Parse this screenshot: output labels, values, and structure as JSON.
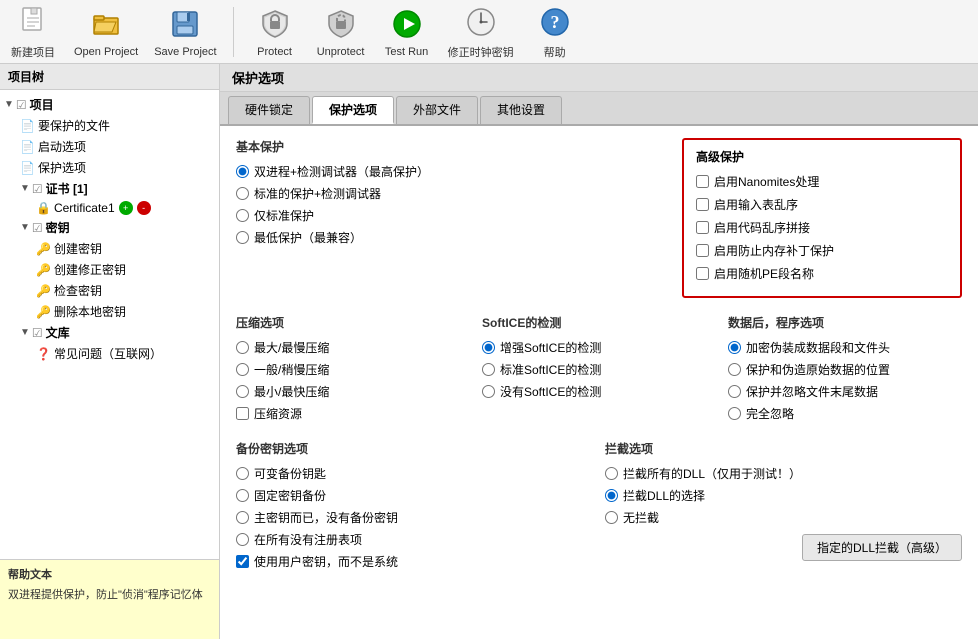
{
  "toolbar": {
    "items": [
      {
        "id": "new-project",
        "label": "新建项目",
        "icon": "📄"
      },
      {
        "id": "open-project",
        "label": "Open Project",
        "icon": "📂"
      },
      {
        "id": "save-project",
        "label": "Save Project",
        "icon": "💾"
      },
      {
        "id": "protect",
        "label": "Protect",
        "icon": "🔒"
      },
      {
        "id": "unprotect",
        "label": "Unprotect",
        "icon": "🔓"
      },
      {
        "id": "test-run",
        "label": "Test Run",
        "icon": "▶"
      },
      {
        "id": "fix-clock-key",
        "label": "修正时钟密钥",
        "icon": "🕐"
      },
      {
        "id": "help",
        "label": "帮助",
        "icon": "❓"
      }
    ]
  },
  "sidebar": {
    "title": "项目树",
    "items": [
      {
        "id": "project-root",
        "label": "项目",
        "level": 0,
        "arrow": "▼",
        "icon": "✓",
        "bold": true
      },
      {
        "id": "files-to-protect",
        "label": "要保护的文件",
        "level": 1,
        "icon": "📄"
      },
      {
        "id": "startup-options",
        "label": "启动选项",
        "level": 1,
        "icon": "📄"
      },
      {
        "id": "protection-options",
        "label": "保护选项",
        "level": 1,
        "icon": "📄"
      },
      {
        "id": "certificates",
        "label": "证书 [1]",
        "level": 1,
        "arrow": "▼",
        "icon": "✓",
        "bold": true
      },
      {
        "id": "certificate1",
        "label": "Certificate1",
        "level": 2,
        "icon": "🔒",
        "badgeGreen": true,
        "badgeRed": true
      },
      {
        "id": "keys",
        "label": "密钥",
        "level": 1,
        "arrow": "▼",
        "icon": "✓",
        "bold": true
      },
      {
        "id": "create-key",
        "label": "创建密钥",
        "level": 2,
        "icon": "🔑"
      },
      {
        "id": "create-mod-key",
        "label": "创建修正密钥",
        "level": 2,
        "icon": "🔑"
      },
      {
        "id": "check-key",
        "label": "检查密钥",
        "level": 2,
        "icon": "🔑"
      },
      {
        "id": "delete-local-key",
        "label": "删除本地密钥",
        "level": 2,
        "icon": "🔑"
      },
      {
        "id": "library",
        "label": "文库",
        "level": 1,
        "arrow": "▼",
        "icon": "✓",
        "bold": true
      },
      {
        "id": "faq",
        "label": "常见问题（互联网）",
        "level": 2,
        "icon": "❓"
      }
    ]
  },
  "help_panel": {
    "title": "帮助文本",
    "content": "双进程提供保护，防止\"侦消\"程序记忆体"
  },
  "content": {
    "title": "保护选项",
    "tabs": [
      {
        "id": "hardware-lock",
        "label": "硬件锁定"
      },
      {
        "id": "protection-options",
        "label": "保护选项",
        "active": true
      },
      {
        "id": "external-files",
        "label": "外部文件"
      },
      {
        "id": "other-settings",
        "label": "其他设置"
      }
    ],
    "advanced_protection": {
      "title": "高级保护",
      "options": [
        {
          "id": "nanomites",
          "label": "启用Nanomites处理",
          "checked": false
        },
        {
          "id": "input-table-disorder",
          "label": "启用输入表乱序",
          "checked": false
        },
        {
          "id": "code-disorder-splice",
          "label": "启用代码乱序拼接",
          "checked": false
        },
        {
          "id": "prevent-memory-patch",
          "label": "启用防止内存补丁保护",
          "checked": false
        },
        {
          "id": "random-pe-name",
          "label": "启用随机PE段名称",
          "checked": false
        }
      ]
    },
    "basic_protection": {
      "title": "基本保护",
      "options": [
        {
          "id": "dual-process-max",
          "label": "双进程+检测调试器（最高保护）",
          "checked": true
        },
        {
          "id": "standard-detect",
          "label": "标准的保护+检测调试器",
          "checked": false
        },
        {
          "id": "standard-only",
          "label": "仅标准保护",
          "checked": false
        },
        {
          "id": "min-compat",
          "label": "最低保护（最兼容）",
          "checked": false
        }
      ]
    },
    "compression": {
      "title": "压缩选项",
      "options": [
        {
          "id": "max-slow",
          "label": "最大/最慢压缩",
          "checked": false
        },
        {
          "id": "normal-slow",
          "label": "一般/稍慢压缩",
          "checked": false
        },
        {
          "id": "min-fast",
          "label": "最小/最快压缩",
          "checked": false
        }
      ],
      "compress_resources": {
        "id": "compress-res",
        "label": "压缩资源",
        "checked": false
      }
    },
    "softice": {
      "title": "SoftICE的检测",
      "options": [
        {
          "id": "softice-enhanced",
          "label": "增强SoftICE的检测",
          "checked": true
        },
        {
          "id": "softice-standard",
          "label": "标准SoftICE的检测",
          "checked": false
        },
        {
          "id": "softice-none",
          "label": "没有SoftICE的检测",
          "checked": false
        }
      ]
    },
    "data_program": {
      "title": "数据后，程序选项",
      "options": [
        {
          "id": "add-fake-data",
          "label": "加密伪装成数据段和文件头",
          "checked": true
        },
        {
          "id": "preserve-source-pos",
          "label": "保护和伪造原始数据的位置",
          "checked": false
        },
        {
          "id": "ignore-file-tail",
          "label": "保护并忽略文件末尾数据",
          "checked": false
        },
        {
          "id": "ignore-all",
          "label": "完全忽略",
          "checked": false
        }
      ]
    },
    "backup_key": {
      "title": "备份密钥选项",
      "options": [
        {
          "id": "variable-backup",
          "label": "可变备份钥匙",
          "checked": false
        },
        {
          "id": "fixed-backup",
          "label": "固定密钥备份",
          "checked": false
        },
        {
          "id": "master-key-only",
          "label": "主密钥而已，没有备份密钥",
          "checked": false
        },
        {
          "id": "no-reg-table",
          "label": "在所有没有注册表项",
          "checked": false
        },
        {
          "id": "use-user-key",
          "label": "使用用户密钥，而不是系统",
          "checked": true
        }
      ]
    },
    "intercept": {
      "title": "拦截选项",
      "options": [
        {
          "id": "intercept-all-dll",
          "label": "拦截所有的DLL（仅用于测试！）",
          "checked": false
        },
        {
          "id": "intercept-selected",
          "label": "拦截DLL的选择",
          "checked": true
        },
        {
          "id": "no-intercept",
          "label": "无拦截",
          "checked": false
        }
      ],
      "dll_button": "指定的DLL拦截（高级）"
    }
  }
}
